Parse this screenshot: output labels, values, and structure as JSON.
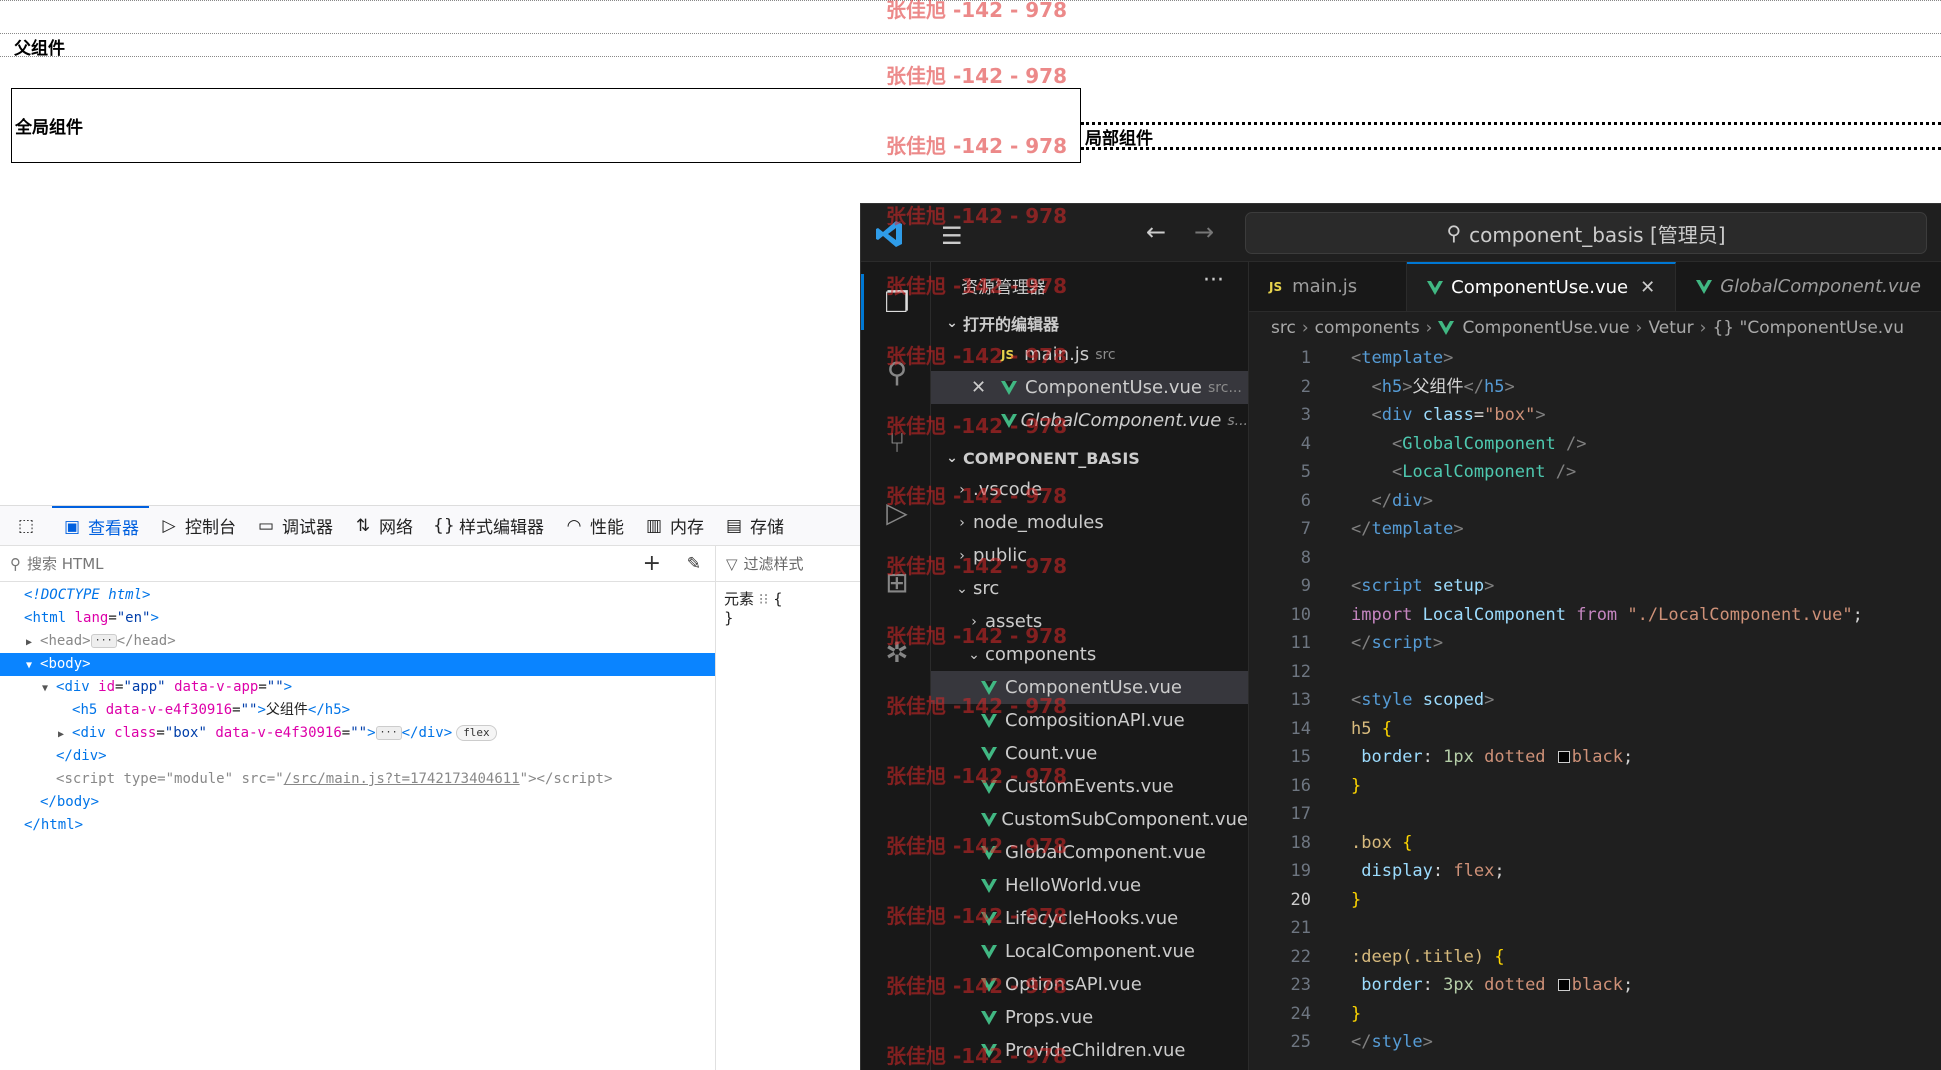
{
  "page": {
    "h5_text": "父组件",
    "global_component_text": "全局组件",
    "local_component_text": "局部组件"
  },
  "watermark": {
    "text": "张佳旭 -142 - 978"
  },
  "devtools": {
    "tabs": [
      {
        "label": "查看器",
        "icon": "inspector-icon",
        "active": true
      },
      {
        "label": "控制台",
        "icon": "console-icon"
      },
      {
        "label": "调试器",
        "icon": "debugger-icon"
      },
      {
        "label": "网络",
        "icon": "network-icon"
      },
      {
        "label": "样式编辑器",
        "icon": "style-editor-icon"
      },
      {
        "label": "性能",
        "icon": "performance-icon"
      },
      {
        "label": "内存",
        "icon": "memory-icon"
      },
      {
        "label": "存储",
        "icon": "storage-icon"
      }
    ],
    "search_placeholder": "搜索 HTML",
    "filter_placeholder": "过滤样式",
    "tree": {
      "doctype": "<!DOCTYPE html>",
      "html_open": "html",
      "html_lang_attr": "lang",
      "html_lang_val": "\"en\"",
      "head_tag": "head",
      "body_tag": "body",
      "div_app_tag": "div",
      "div_app_id_attr": "id",
      "div_app_id_val": "\"app\"",
      "div_app_dv_attr": "data-v-app",
      "div_app_dv_val": "\"\"",
      "h5_tag": "h5",
      "h5_attr": "data-v-e4f30916",
      "h5_val": "\"\"",
      "h5_text": "父组件",
      "box_tag": "div",
      "box_class_attr": "class",
      "box_class_val": "\"box\"",
      "box_dv_attr": "data-v-e4f30916",
      "box_dv_val": "\"\"",
      "box_badge": "flex",
      "script_tag": "script",
      "script_type_attr": "type",
      "script_type_val": "\"module\"",
      "script_src_attr": "src",
      "script_src_val": "/src/main.js?t=1742173404611"
    },
    "rules": {
      "selector": "元素",
      "open": "{",
      "close": "}"
    }
  },
  "vscode": {
    "command_center": "component_basis [管理员]",
    "explorer_title": "资源管理器",
    "open_editors_title": "打开的编辑器",
    "open_editors": [
      {
        "name": "main.js",
        "hint": "src",
        "kind": "js"
      },
      {
        "name": "ComponentUse.vue",
        "hint": "src...",
        "kind": "vue",
        "active": true
      },
      {
        "name": "GlobalComponent.vue",
        "hint": "s...",
        "kind": "vue",
        "italic": true
      }
    ],
    "project_title": "COMPONENT_BASIS",
    "folders": {
      "vscode": ".vscode",
      "node_modules": "node_modules",
      "public": "public",
      "src": "src",
      "assets": "assets",
      "components": "components"
    },
    "component_files": [
      "ComponentUse.vue",
      "CompositionAPI.vue",
      "Count.vue",
      "CustomEvents.vue",
      "CustomSubComponent.vue",
      "GlobalComponent.vue",
      "HelloWorld.vue",
      "LifecycleHooks.vue",
      "LocalComponent.vue",
      "OptionsAPI.vue",
      "Props.vue",
      "ProvideChildren.vue"
    ],
    "tabs": [
      {
        "label": "main.js",
        "kind": "js"
      },
      {
        "label": "ComponentUse.vue",
        "kind": "vue",
        "active": true
      },
      {
        "label": "GlobalComponent.vue",
        "kind": "vue",
        "italic": true
      }
    ],
    "breadcrumb": [
      "src",
      "components",
      "ComponentUse.vue",
      "Vetur",
      "{} \"ComponentUse.vu"
    ],
    "current_line": "20",
    "line_numbers": [
      "1",
      "2",
      "3",
      "4",
      "5",
      "6",
      "7",
      "8",
      "9",
      "10",
      "11",
      "12",
      "13",
      "14",
      "15",
      "16",
      "17",
      "18",
      "19",
      "20",
      "21",
      "22",
      "23",
      "24",
      "25"
    ],
    "code": {
      "template": "template",
      "h5": "h5",
      "h5_text": "父组件",
      "div": "div",
      "class": "class",
      "box": "\"box\"",
      "global": "GlobalComponent",
      "local": "LocalComponent",
      "script": "script",
      "setup": "setup",
      "import": "import",
      "from": "from",
      "path": "\"./LocalComponent.vue\"",
      "style": "style",
      "scoped": "scoped",
      "h5_sel": "h5",
      "border": "border",
      "one_px": "1px",
      "dotted": "dotted",
      "black": "black",
      "box_sel": ".box",
      "display": "display",
      "flex": "flex",
      "deep": ":deep(.title)",
      "three_px": "3px"
    }
  }
}
